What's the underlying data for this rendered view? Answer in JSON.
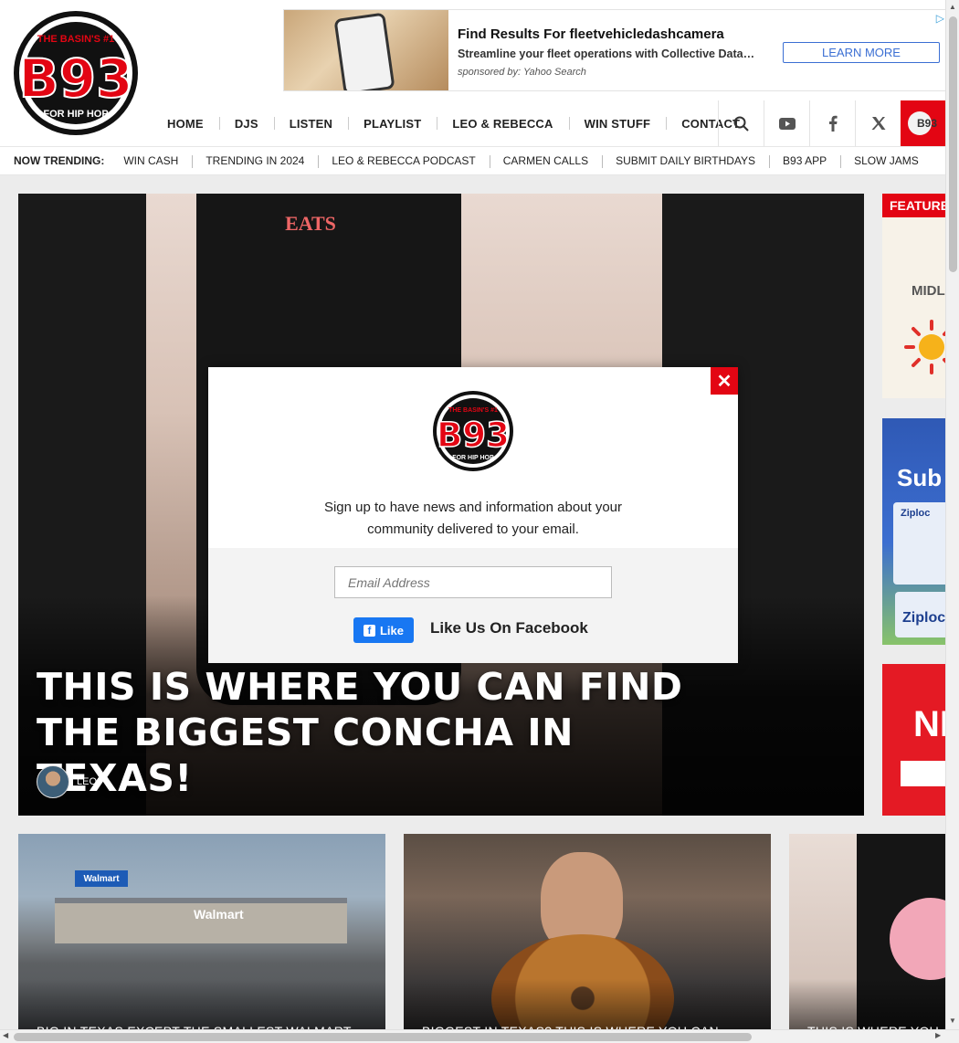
{
  "brand": {
    "logo_text_top": "THE BASIN'S #1",
    "logo_number": "B93",
    "logo_text_bottom": "FOR HIP HOP",
    "accent_color": "#e30513"
  },
  "top_ad": {
    "title": "Find Results For fleetvehicledashcamera",
    "description": "Streamline your fleet operations with Collective Data…",
    "sponsor": "sponsored by: Yahoo Search",
    "cta": "LEARN MORE",
    "adchoices_icon": "adchoices-icon"
  },
  "nav": {
    "items": [
      {
        "label": "HOME"
      },
      {
        "label": "DJS"
      },
      {
        "label": "LISTEN"
      },
      {
        "label": "PLAYLIST"
      },
      {
        "label": "LEO & REBECCA"
      },
      {
        "label": "WIN STUFF"
      },
      {
        "label": "CONTACT"
      }
    ],
    "social_icons": [
      "search-icon",
      "youtube-icon",
      "facebook-icon",
      "twitter-icon"
    ],
    "listen_label": "B93"
  },
  "trending": {
    "label": "NOW TRENDING:",
    "items": [
      {
        "label": "WIN CASH"
      },
      {
        "label": "TRENDING IN 2024"
      },
      {
        "label": "LEO & REBECCA PODCAST"
      },
      {
        "label": "CARMEN CALLS"
      },
      {
        "label": "SUBMIT DAILY BIRTHDAYS"
      },
      {
        "label": "B93 APP"
      },
      {
        "label": "SLOW JAMS"
      }
    ]
  },
  "hero": {
    "headline": "THIS IS WHERE YOU CAN FIND THE BIGGEST CONCHA IN TEXAS!",
    "author": "LEO",
    "shirt_logo": "EATS"
  },
  "right_rail": {
    "featured_title": "FEATURED",
    "featured_text": "MIDL",
    "ad_zip_text": "Sub",
    "ad_zip_brand": "Ziploc",
    "ad_red_text": "NE"
  },
  "cards": [
    {
      "title": "BIG IN TEXAS EXCEPT THE SMALLEST WALMART",
      "sign": "Walmart"
    },
    {
      "title": "BIGGEST IN TEXAS? THIS IS WHERE YOU CAN"
    },
    {
      "title": "THIS IS WHERE YOU"
    }
  ],
  "modal": {
    "close_icon": "close-icon",
    "message": "Sign up to have news and information about your community delivered to your email.",
    "email_placeholder": "Email Address",
    "fb_like_label": "Like",
    "fb_text": "Like Us On Facebook"
  }
}
